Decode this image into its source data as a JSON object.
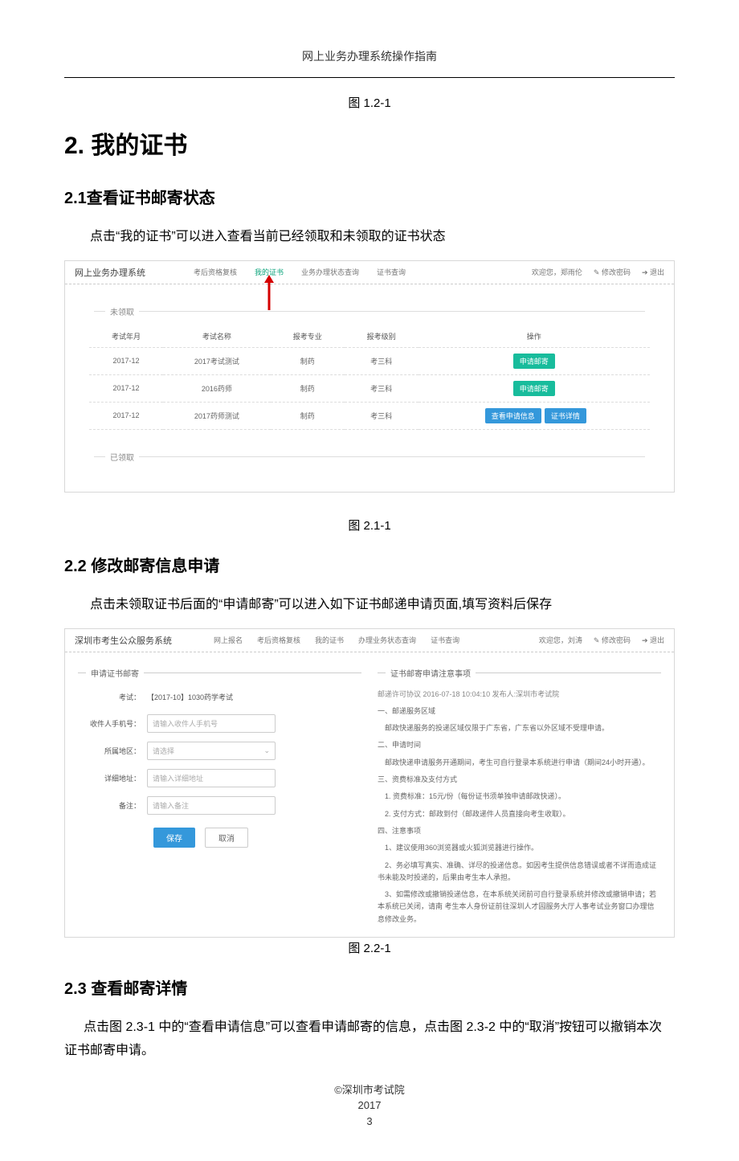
{
  "running_header": "网上业务办理系统操作指南",
  "fig_1_2_1": "图 1.2-1",
  "h1": "2. 我的证书",
  "s21_title": "2.1查看证书邮寄状态",
  "s21_text": "点击“我的证书”可以进入查看当前已经领取和未领取的证书状态",
  "shot1": {
    "brand": "网上业务办理系统",
    "nav": [
      "考后资格复核",
      "我的证书",
      "业务办理状态查询",
      "证书查询"
    ],
    "welcome": "欢迎您，郑雨伦",
    "change_pwd": "✎ 修改密码",
    "logout": "➔ 退出",
    "group_unclaimed": "未领取",
    "group_claimed": "已领取",
    "headers": [
      "考试年月",
      "考试名称",
      "报考专业",
      "报考级别",
      "操作"
    ],
    "rows": [
      {
        "ym": "2017-12",
        "name": "2017考试测试",
        "major": "制药",
        "level": "考三科",
        "actions": [
          {
            "label": "申请邮寄",
            "cls": "btn-green"
          }
        ]
      },
      {
        "ym": "2017-12",
        "name": "2016药师",
        "major": "制药",
        "level": "考三科",
        "actions": [
          {
            "label": "申请邮寄",
            "cls": "btn-green"
          }
        ]
      },
      {
        "ym": "2017-12",
        "name": "2017药师测试",
        "major": "制药",
        "level": "考三科",
        "actions": [
          {
            "label": "查看申请信息",
            "cls": "btn-blue"
          },
          {
            "label": "证书详情",
            "cls": "btn-blue"
          }
        ]
      }
    ]
  },
  "fig_2_1_1": "图 2.1-1",
  "s22_title": "2.2  修改邮寄信息申请",
  "s22_text": "点击未领取证书后面的“申请邮寄”可以进入如下证书邮递申请页面,填写资料后保存",
  "shot2": {
    "brand": "深圳市考生公众服务系统",
    "nav": [
      "网上报名",
      "考后资格复核",
      "我的证书",
      "办理业务状态查询",
      "证书查询"
    ],
    "welcome": "欢迎您，刘涛",
    "change_pwd": "✎ 修改密码",
    "logout": "➔ 退出",
    "left_title": "申请证书邮寄",
    "right_title": "证书邮寄申请注意事项",
    "fields": {
      "exam_label": "考试：",
      "exam_value": "【2017-10】1030药学考试",
      "phone_label": "收件人手机号：",
      "phone_placeholder": "请输入收件人手机号",
      "region_label": "所属地区：",
      "region_placeholder": "请选择",
      "addr_label": "详细地址：",
      "addr_placeholder": "请输入详细地址",
      "remark_label": "备注：",
      "remark_placeholder": "请输入备注"
    },
    "save": "保存",
    "cancel": "取消",
    "notice": {
      "meta": "邮递许可协议 2016-07-18 10:04:10 发布人:深圳市考试院",
      "lines": [
        "一、邮递服务区域",
        "　邮政快递服务的投递区域仅限于广东省，广东省以外区域不受理申请。",
        "二、申请时间",
        "　邮政快递申请服务开通期间，考生可自行登录本系统进行申请（期间24小时开通）。",
        "三、资费标准及支付方式",
        "　1. 资费标准：15元/份（每份证书须单独申请邮政快递）。",
        "　2. 支付方式：邮政到付（邮政递件人员直接向考生收取）。",
        "四、注意事项",
        "　1、建议使用360浏览器或火狐浏览器进行操作。",
        "　2、务必填写真实、准确、详尽的投递信息。如因考生提供信息错误或者不详而造成证书未能及时投递的，后果由考生本人承担。",
        "　3、如需修改或撤销投递信息，在本系统关闭前可自行登录系统并修改或撤销申请；若本系统已关闭，请南 考生本人身份证前往深圳人才园服务大厅人事考试业务窗口办理信息修改业务。"
      ]
    }
  },
  "fig_2_2_1": "图 2.2-1",
  "s23_title": "2.3  查看邮寄详情",
  "s23_text": "点击图 2.3-1 中的“查看申请信息”可以查看申请邮寄的信息，点击图 2.3-2 中的“取消”按钮可以撤销本次证书邮寄申请。",
  "footer_org": "©深圳市考试院",
  "footer_year": "2017",
  "footer_page": "3"
}
